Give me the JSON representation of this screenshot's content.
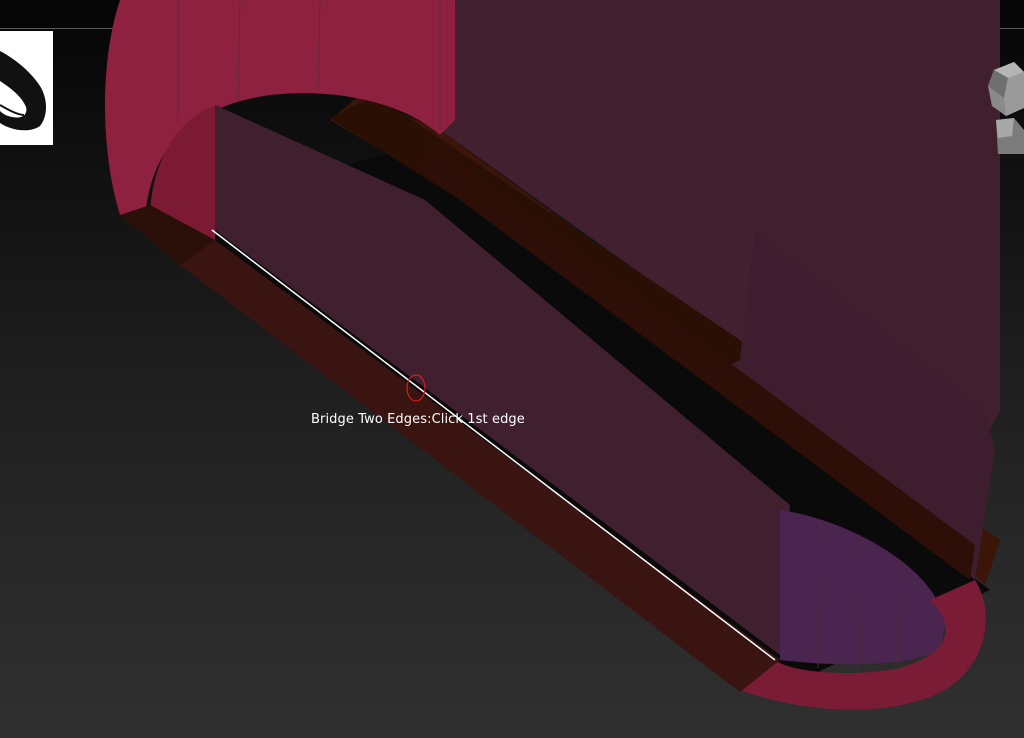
{
  "canvas": {
    "background_top": "#050505",
    "background_bottom": "#303030",
    "divider_color": "#5a5a5a"
  },
  "model": {
    "front_face_color": "#40202f",
    "side_wall_color": "#3a1410",
    "cap_color": "#8e2140",
    "inner_cap_color": "#4a2550",
    "selected_edge_color": "#ffffff"
  },
  "toolbar": {
    "brush_icon": "brush-thumbnail-icon",
    "view_icon": "head-view-icon"
  },
  "status": {
    "message": "Bridge Two Edges:Click 1st edge"
  },
  "cursor": {
    "icon": "brush-cursor-circle-icon",
    "color": "#d81e1e"
  }
}
